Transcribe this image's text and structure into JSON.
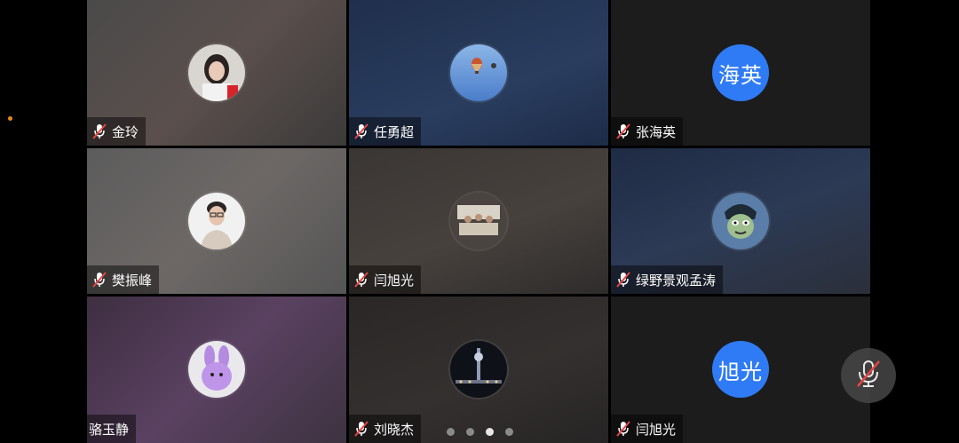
{
  "participants": [
    {
      "name": "金玲",
      "avatar_type": "photo",
      "avatar_icon": "girl-portrait-icon",
      "muted": true
    },
    {
      "name": "任勇超",
      "avatar_type": "photo",
      "avatar_icon": "hot-air-balloon-icon",
      "muted": true
    },
    {
      "name": "张海英",
      "avatar_type": "text",
      "avatar_text": "海英",
      "muted": true
    },
    {
      "name": "樊振峰",
      "avatar_type": "photo",
      "avatar_icon": "man-portrait-icon",
      "muted": true
    },
    {
      "name": "闫旭光",
      "avatar_type": "photo",
      "avatar_icon": "group-photo-icon",
      "muted": true
    },
    {
      "name": "绿野景观孟涛",
      "avatar_type": "photo",
      "avatar_icon": "cartoon-character-icon",
      "muted": true
    },
    {
      "name": "骆玉静",
      "avatar_type": "photo",
      "avatar_icon": "purple-bunny-icon",
      "muted": false
    },
    {
      "name": "刘晓杰",
      "avatar_type": "photo",
      "avatar_icon": "night-city-icon",
      "muted": true
    },
    {
      "name": "闫旭光",
      "avatar_type": "text",
      "avatar_text": "旭光",
      "muted": true
    }
  ],
  "pagination": {
    "total_pages": 4,
    "current_page": 3
  },
  "colors": {
    "avatar_blue": "#2f7bf5",
    "mute_red": "#e64545",
    "indicator_orange": "#e8891c"
  },
  "float_button": {
    "icon": "microphone-muted-icon"
  }
}
